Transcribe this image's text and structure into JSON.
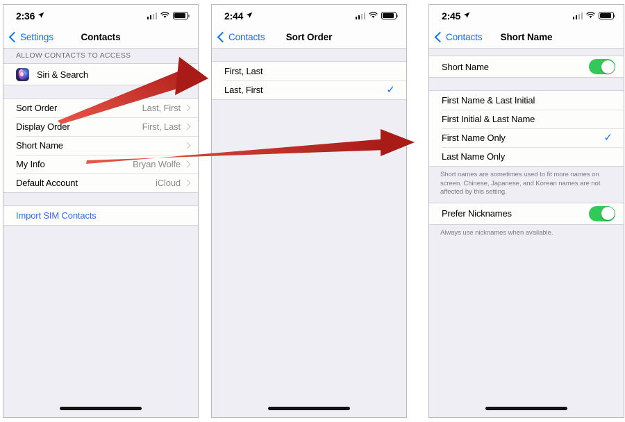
{
  "panels": [
    {
      "id": "contacts-settings",
      "status": {
        "time": "2:36",
        "location_icon": "location-arrow-icon",
        "signal_icon": "cellular-signal-icon",
        "wifi_icon": "wifi-icon",
        "battery_icon": "battery-icon"
      },
      "nav": {
        "back_label": "Settings",
        "title": "Contacts"
      },
      "group_header": "ALLOW CONTACTS TO ACCESS",
      "access_row": {
        "icon": "siri-app-icon",
        "label": "Siri & Search",
        "chevron": "chevron-right-icon"
      },
      "settings_rows": [
        {
          "label": "Sort Order",
          "value": "Last, First",
          "chevron": "chevron-right-icon"
        },
        {
          "label": "Display Order",
          "value": "First, Last",
          "chevron": "chevron-right-icon"
        },
        {
          "label": "Short Name",
          "value": "",
          "chevron": "chevron-right-icon"
        },
        {
          "label": "My Info",
          "value": "Bryan Wolfe",
          "chevron": "chevron-right-icon"
        },
        {
          "label": "Default Account",
          "value": "iCloud",
          "chevron": "chevron-right-icon"
        }
      ],
      "action_row": {
        "label": "Import SIM Contacts"
      }
    },
    {
      "id": "sort-order",
      "status": {
        "time": "2:44",
        "location_icon": "location-arrow-icon",
        "signal_icon": "cellular-signal-icon",
        "wifi_icon": "wifi-icon",
        "battery_icon": "battery-icon"
      },
      "nav": {
        "back_label": "Contacts",
        "title": "Sort Order"
      },
      "options": [
        {
          "label": "First, Last",
          "selected": false
        },
        {
          "label": "Last, First",
          "selected": true
        }
      ],
      "checkmark": "✓"
    },
    {
      "id": "short-name",
      "status": {
        "time": "2:45",
        "location_icon": "location-arrow-icon",
        "signal_icon": "cellular-signal-icon",
        "wifi_icon": "wifi-icon",
        "battery_icon": "battery-icon"
      },
      "nav": {
        "back_label": "Contacts",
        "title": "Short Name"
      },
      "master_toggle": {
        "label": "Short Name",
        "on": true
      },
      "options": [
        {
          "label": "First Name & Last Initial",
          "selected": false
        },
        {
          "label": "First Initial & Last Name",
          "selected": false
        },
        {
          "label": "First Name Only",
          "selected": true
        },
        {
          "label": "Last Name Only",
          "selected": false
        }
      ],
      "checkmark": "✓",
      "note": "Short names are sometimes used to fit more names on screen. Chinese, Japanese, and Korean names are not affected by this setting.",
      "nickname_toggle": {
        "label": "Prefer Nicknames",
        "on": true
      },
      "nickname_note": "Always use nicknames when available."
    }
  ],
  "annotations": {
    "arrow_color": "#C0241F",
    "arrow_color_light": "#E0483C",
    "arrow1_name": "arrow-sort-order-to-sort-screen",
    "arrow2_name": "arrow-short-name-to-short-name-screen"
  }
}
